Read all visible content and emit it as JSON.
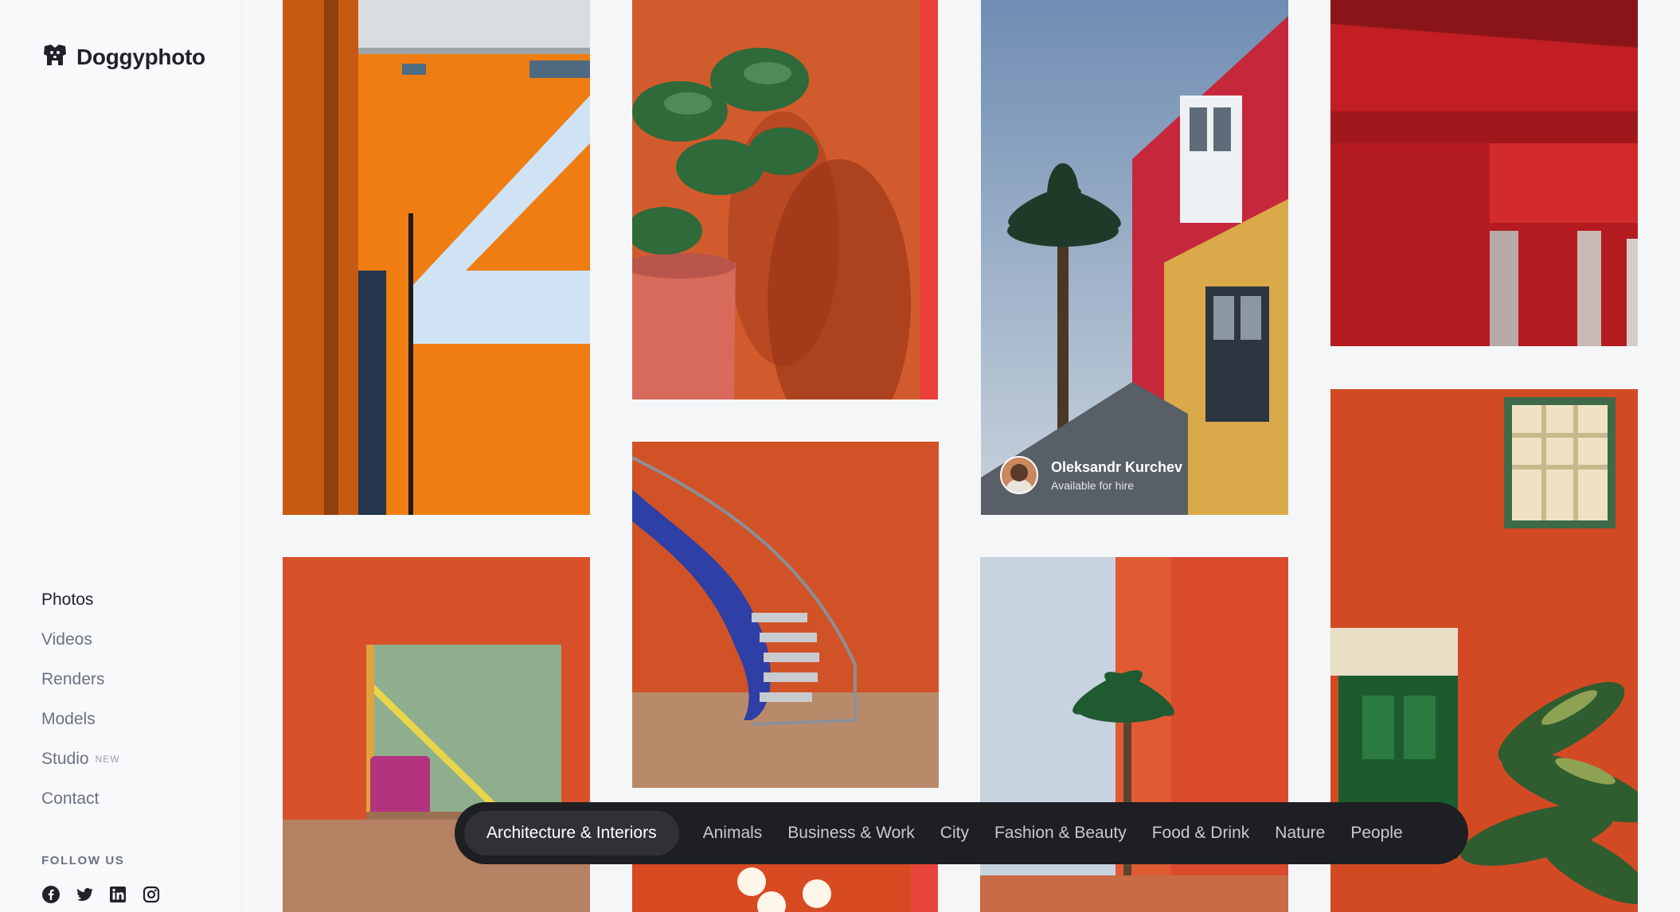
{
  "app": {
    "brand": "Doggyphoto",
    "logo_icon": "dog-logo-icon"
  },
  "sidebar": {
    "nav": [
      {
        "label": "Photos",
        "active": true
      },
      {
        "label": "Videos",
        "active": false
      },
      {
        "label": "Renders",
        "active": false
      },
      {
        "label": "Models",
        "active": false
      },
      {
        "label": "Studio",
        "badge": "NEW",
        "active": false
      },
      {
        "label": "Contact",
        "active": false
      }
    ],
    "follow_label": "FOLLOW US",
    "social": [
      "facebook-icon",
      "twitter-icon",
      "linkedin-icon",
      "instagram-icon"
    ]
  },
  "gallery": {
    "credit": {
      "name": "Oleksandr Kurchev",
      "status": "Available for hire"
    }
  },
  "categories": {
    "items": [
      "Architecture & Interiors",
      "Animals",
      "Business & Work",
      "City",
      "Fashion & Beauty",
      "Food & Drink",
      "Nature",
      "People"
    ],
    "active": "Architecture & Interiors"
  },
  "colors": {
    "category_bar": "#1e1f22",
    "accent_orange": "#e8601f",
    "accent_red": "#c41e1e"
  }
}
